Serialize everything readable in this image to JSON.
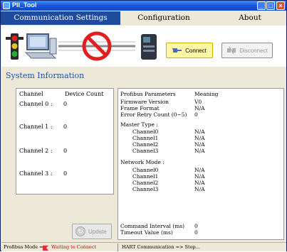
{
  "window": {
    "title": "PII_Tool"
  },
  "tabs": [
    {
      "label": "Communication Settings"
    },
    {
      "label": "Configuration"
    },
    {
      "label": "About"
    }
  ],
  "toolbar": {
    "connect_label": "Connect",
    "disconnect_label": "Disconnect"
  },
  "section": {
    "title": "System Information"
  },
  "channels": {
    "headers": {
      "channel": "Channel",
      "count": "Device Count"
    },
    "rows": [
      {
        "label": "Channel 0 :",
        "count": "0"
      },
      {
        "label": "Channel 1 :",
        "count": "0"
      },
      {
        "label": "Channel 2 :",
        "count": "0"
      },
      {
        "label": "Channel 3 :",
        "count": "0"
      }
    ],
    "update_label": "Update"
  },
  "params": {
    "headers": {
      "param": "Profibus Parameters",
      "meaning": "Meaning"
    },
    "firmware": {
      "label": "Firmware Version",
      "value": "V0"
    },
    "frame": {
      "label": "Frame Format",
      "value": "N/A"
    },
    "retry": {
      "label": "Error Retry Count (0~5)",
      "value": "0"
    },
    "master_type": {
      "label": "Master Type :",
      "channels": [
        {
          "label": "Channel0",
          "value": "N/A"
        },
        {
          "label": "Channel1",
          "value": "N/A"
        },
        {
          "label": "Channel2",
          "value": "N/A"
        },
        {
          "label": "Channel3",
          "value": "N/A"
        }
      ]
    },
    "network_mode": {
      "label": "Network Mode :",
      "channels": [
        {
          "label": "Channel0",
          "value": "N/A"
        },
        {
          "label": "Channel1",
          "value": "N/A"
        },
        {
          "label": "Channel2",
          "value": "N/A"
        },
        {
          "label": "Channel3",
          "value": "N/A"
        }
      ]
    },
    "command_interval": {
      "label": "Command Interval (ms)",
      "value": "0"
    },
    "timeout": {
      "label": "Timeout Value (ms)",
      "value": "0"
    }
  },
  "status": {
    "profibus_mode_label": "Profibus Mode =>",
    "waiting_text": "Waiting to Connect",
    "hart_text": "HART Communication => Stop..."
  },
  "colors": {
    "title_bar": "#1656d8",
    "active_tab": "#1e4b9c",
    "section_title": "#2450a8",
    "waiting_text": "#cc0000",
    "connect_button": "#fff8a6"
  }
}
